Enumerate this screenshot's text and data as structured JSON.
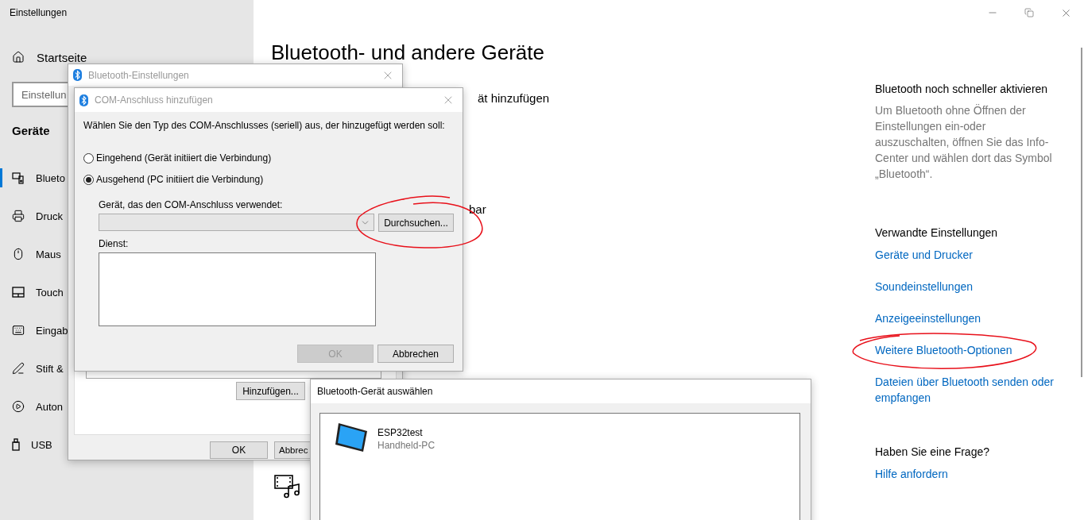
{
  "settings_window": {
    "title": "Einstellungen"
  },
  "sidebar": {
    "home": "Startseite",
    "search_placeholder": "Einstellun",
    "section": "Geräte",
    "items": [
      {
        "label": "Blueto",
        "kind": "devices",
        "selected": true
      },
      {
        "label": "Druck",
        "kind": "printer",
        "selected": false
      },
      {
        "label": "Maus",
        "kind": "mouse",
        "selected": false
      },
      {
        "label": "Touch",
        "kind": "touchpad",
        "selected": false
      },
      {
        "label": "Eingab",
        "kind": "keyboard",
        "selected": false
      },
      {
        "label": "Stift &",
        "kind": "pen",
        "selected": false
      },
      {
        "label": "Auton",
        "kind": "autoplay",
        "selected": false
      },
      {
        "label": "USB",
        "kind": "usb",
        "selected": false
      }
    ]
  },
  "main": {
    "title": "Bluetooth- und andere Geräte",
    "fragments": [
      "ät hinzufügen",
      "bar"
    ]
  },
  "right_panel": {
    "sections": [
      {
        "heading": "Bluetooth noch schneller aktivieren",
        "text": "Um Bluetooth ohne Öffnen der Einstellungen ein-oder auszuschalten, öffnen Sie das Info-Center und wählen dort das Symbol „Bluetooth“."
      },
      {
        "heading": "Verwandte Einstellungen",
        "links": [
          "Geräte und Drucker",
          "Soundeinstellungen",
          "Anzeigeeinstellungen",
          "Weitere Bluetooth-Optionen",
          "Dateien über Bluetooth senden oder empfangen"
        ]
      },
      {
        "heading": "Haben Sie eine Frage?",
        "links": [
          "Hilfe anfordern"
        ]
      }
    ]
  },
  "bt_settings_dialog": {
    "title": "Bluetooth-Einstellungen",
    "add_button": "Hinzufügen...",
    "buttons": [
      "OK",
      "Abbrec"
    ]
  },
  "com_dialog": {
    "title": "COM-Anschluss hinzufügen",
    "prompt": "Wählen Sie den Typ des COM-Anschlusses (seriell) aus, der hinzugefügt werden soll:",
    "options": [
      {
        "label": "Eingehend (Gerät initiiert die Verbindung)",
        "selected": false
      },
      {
        "label": "Ausgehend (PC initiiert die Verbindung)",
        "selected": true
      }
    ],
    "device_label": "Gerät, das den COM-Anschluss verwendet:",
    "device_select": {
      "disabled": true
    },
    "browse_button": "Durchsuchen...",
    "service_label": "Dienst:",
    "buttons": [
      {
        "label": "OK",
        "disabled": true
      },
      {
        "label": "Abbrechen",
        "disabled": false
      }
    ]
  },
  "device_picker": {
    "title": "Bluetooth-Gerät auswählen",
    "devices": [
      {
        "name": "ESP32test",
        "type": "Handheld-PC"
      }
    ]
  }
}
